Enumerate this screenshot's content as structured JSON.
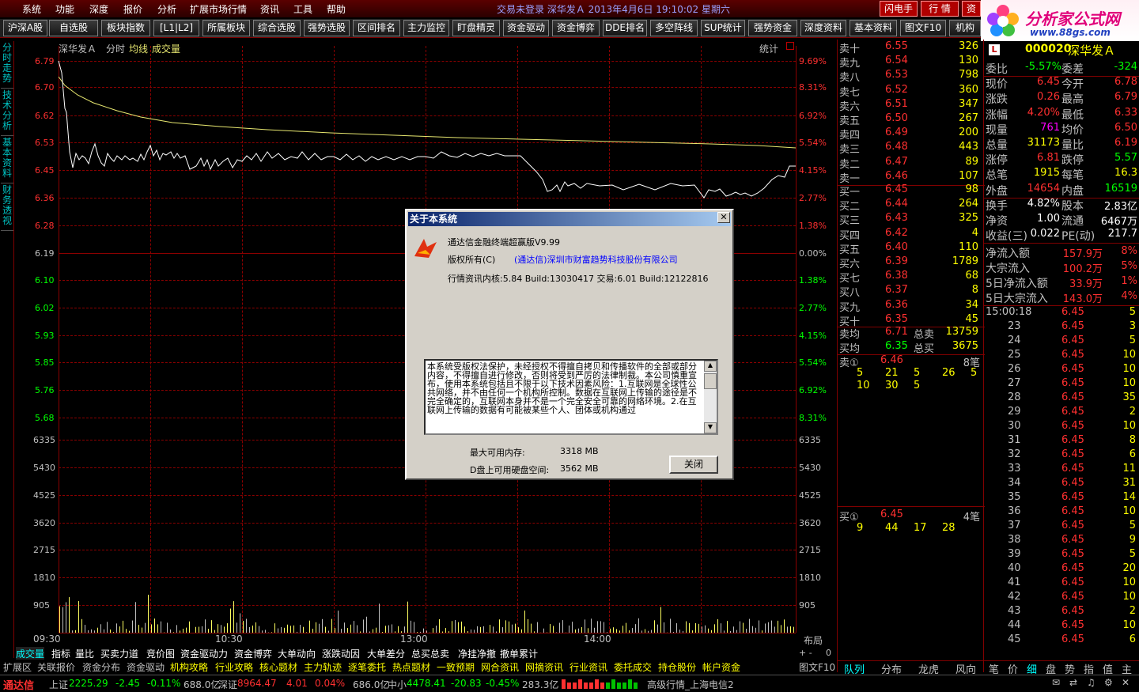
{
  "menu": {
    "items": [
      "系统",
      "功能",
      "深度",
      "报价",
      "分析",
      "扩展市场行情",
      "资讯",
      "工具",
      "帮助"
    ],
    "title_info": "交易未登录    深华发Ａ    2013年4月6日  19:10:02  星期六",
    "flash_label": "闪电手",
    "quote_label": "行 情",
    "extra_label": "资"
  },
  "logo": {
    "text": "分析家公式网",
    "url": "www.88gs.com"
  },
  "toolbar": [
    "沪深A股",
    "自选股",
    "板块指数",
    "[L1|L2]",
    "所属板块",
    "综合选股",
    "强势选股",
    "区间排名",
    "主力监控",
    "盯盘精灵",
    "资金驱动",
    "资金博弈",
    "DDE排名",
    "多空阵线",
    "SUP统计",
    "强势资金",
    "深度资料",
    "基本资料",
    "图文F10",
    "机构"
  ],
  "left_tabs": [
    "分时走势",
    "技术分析",
    "基本资料",
    "财务透视"
  ],
  "chart": {
    "header_name": "深华发Ａ",
    "header_mode": "分时",
    "header_avg": "均线",
    "header_vol": "成交量",
    "stats_label": "统计",
    "price_labels": [
      "6.79",
      "6.70",
      "6.62",
      "6.53",
      "6.45",
      "6.36",
      "6.28",
      "6.19",
      "6.10",
      "6.02",
      "5.93",
      "5.85",
      "5.76",
      "5.68"
    ],
    "pct_labels": [
      "9.69%",
      "8.31%",
      "6.92%",
      "5.54%",
      "4.15%",
      "2.77%",
      "1.38%",
      "0.00%",
      "1.38%",
      "2.77%",
      "4.15%",
      "5.54%",
      "6.92%",
      "8.31%"
    ],
    "vol_labels": [
      "6335",
      "5430",
      "4525",
      "3620",
      "2715",
      "1810",
      "905"
    ],
    "time_labels": [
      "09:30",
      "10:30",
      "13:00",
      "14:00"
    ],
    "layout_label": "布局",
    "plus_minus": "+ -",
    "zero": "0",
    "colors": {
      "up": "#ff3030",
      "down": "#00ff00",
      "price_line": "#ffffff",
      "avg_line": "#e8e870",
      "grid": "#8b0000"
    }
  },
  "bottom_tabs1": [
    "成交量",
    "指标",
    "量比",
    "买卖力道",
    "竞价图",
    "资金驱动力",
    "资金博弈",
    "大单动向",
    "涨跌动因",
    "大单差分",
    "总买总卖",
    "净挂净撤",
    "撤单累计"
  ],
  "bottom_tabs2": [
    "扩展区",
    "关联报价",
    "资金分布",
    "资金驱动",
    "机构攻略",
    "行业攻略",
    "核心题材",
    "主力轨迹",
    "逐笔委托",
    "热点题材",
    "一致预期",
    "网合资讯",
    "网摘资讯",
    "行业资讯",
    "委托成交",
    "持仓股份",
    "帐户资金"
  ],
  "graphic_f10": "图文F10",
  "orderbook": {
    "sells": [
      {
        "label": "卖十",
        "price": "6.55",
        "vol": "326"
      },
      {
        "label": "卖九",
        "price": "6.54",
        "vol": "130"
      },
      {
        "label": "卖八",
        "price": "6.53",
        "vol": "798"
      },
      {
        "label": "卖七",
        "price": "6.52",
        "vol": "360"
      },
      {
        "label": "卖六",
        "price": "6.51",
        "vol": "347"
      },
      {
        "label": "卖五",
        "price": "6.50",
        "vol": "267"
      },
      {
        "label": "卖四",
        "price": "6.49",
        "vol": "200"
      },
      {
        "label": "卖三",
        "price": "6.48",
        "vol": "443"
      },
      {
        "label": "卖二",
        "price": "6.47",
        "vol": "89"
      },
      {
        "label": "卖一",
        "price": "6.46",
        "vol": "107"
      }
    ],
    "buys": [
      {
        "label": "买一",
        "price": "6.45",
        "vol": "98"
      },
      {
        "label": "买二",
        "price": "6.44",
        "vol": "264"
      },
      {
        "label": "买三",
        "price": "6.43",
        "vol": "325"
      },
      {
        "label": "买四",
        "price": "6.42",
        "vol": "4"
      },
      {
        "label": "买五",
        "price": "6.40",
        "vol": "110"
      },
      {
        "label": "买六",
        "price": "6.39",
        "vol": "1789"
      },
      {
        "label": "买七",
        "price": "6.38",
        "vol": "68"
      },
      {
        "label": "买八",
        "price": "6.37",
        "vol": "8"
      },
      {
        "label": "买九",
        "price": "6.36",
        "vol": "34"
      },
      {
        "label": "买十",
        "price": "6.35",
        "vol": "45"
      }
    ],
    "sell_avg_label": "卖均",
    "sell_avg": "6.71",
    "total_sell_label": "总卖",
    "total_sell": "13759",
    "buy_avg_label": "买均",
    "buy_avg": "6.35",
    "total_buy_label": "总买",
    "total_buy": "3675",
    "sell_queue_label": "卖①",
    "sell_queue_price": "6.46",
    "sell_queue_count": "8笔",
    "sell_queue": [
      "5",
      "21",
      "5",
      "26",
      "5",
      "10",
      "30",
      "5"
    ],
    "buy_queue_label": "买①",
    "buy_queue_price": "6.45",
    "buy_queue_count": "4笔",
    "buy_queue": [
      "9",
      "44",
      "17",
      "28"
    ],
    "tabs": [
      "队列",
      "分布",
      "龙虎",
      "风向"
    ]
  },
  "quote": {
    "code": "000020",
    "name": "深华发Ａ",
    "badge": "L",
    "rows": [
      [
        "委比",
        "-5.57%",
        "委差",
        "-324"
      ],
      [
        "现价",
        "6.45",
        "今开",
        "6.78"
      ],
      [
        "涨跌",
        "0.26",
        "最高",
        "6.79"
      ],
      [
        "涨幅",
        "4.20%",
        "最低",
        "6.33"
      ],
      [
        "现量",
        "761",
        "均价",
        "6.50"
      ],
      [
        "总量",
        "31173",
        "量比",
        "6.19"
      ],
      [
        "涨停",
        "6.81",
        "跌停",
        "5.57"
      ],
      [
        "总笔",
        "1915",
        "每笔",
        "16.3"
      ],
      [
        "外盘",
        "14654",
        "内盘",
        "16519"
      ],
      [
        "换手",
        "4.82%",
        "股本",
        "2.83亿"
      ],
      [
        "净资",
        "1.00",
        "流通",
        "6467万"
      ],
      [
        "收益(三)",
        "0.022",
        "PE(动)",
        "217.7"
      ]
    ],
    "flows": [
      [
        "净流入额",
        "157.9万",
        "8%"
      ],
      [
        "大宗流入",
        "100.2万",
        "5%"
      ],
      [
        "5日净流入额",
        "33.9万",
        "1%"
      ],
      [
        "5日大宗流入",
        "143.0万",
        "4%"
      ]
    ],
    "ticks_first_time": "15:00:18",
    "ticks": [
      [
        "",
        "6.45",
        "5"
      ],
      [
        "23",
        "6.45",
        "3"
      ],
      [
        "24",
        "6.45",
        "5"
      ],
      [
        "25",
        "6.45",
        "10"
      ],
      [
        "26",
        "6.45",
        "10"
      ],
      [
        "27",
        "6.45",
        "10"
      ],
      [
        "28",
        "6.45",
        "35"
      ],
      [
        "29",
        "6.45",
        "2"
      ],
      [
        "30",
        "6.45",
        "10"
      ],
      [
        "31",
        "6.45",
        "8"
      ],
      [
        "32",
        "6.45",
        "6"
      ],
      [
        "33",
        "6.45",
        "11"
      ],
      [
        "34",
        "6.45",
        "31"
      ],
      [
        "35",
        "6.45",
        "14"
      ],
      [
        "36",
        "6.45",
        "10"
      ],
      [
        "37",
        "6.45",
        "5"
      ],
      [
        "38",
        "6.45",
        "9"
      ],
      [
        "39",
        "6.45",
        "5"
      ],
      [
        "40",
        "6.45",
        "20"
      ],
      [
        "41",
        "6.45",
        "10"
      ],
      [
        "42",
        "6.45",
        "10"
      ],
      [
        "43",
        "6.45",
        "2"
      ],
      [
        "44",
        "6.45",
        "10"
      ],
      [
        "45",
        "6.45",
        "6"
      ]
    ],
    "tabs": [
      "笔",
      "价",
      "细",
      "盘",
      "势",
      "指",
      "值",
      "主"
    ]
  },
  "status": {
    "brand": "通达信",
    "sh_label": "上证",
    "sh": "2225.29",
    "sh_chg": "-2.45",
    "sh_pct": "-0.11%",
    "sh_amt": "688.0亿",
    "sz_label": "深证",
    "sz": "8964.47",
    "sz_chg": "4.01",
    "sz_pct": "0.04%",
    "sz_amt": "686.0亿",
    "zx_label": "中小",
    "zx": "4478.41",
    "zx_chg": "-20.83",
    "zx_pct": "-0.45%",
    "zx_amt": "283.3亿",
    "server": "高级行情_上海电信2"
  },
  "dialog": {
    "title": "关于本系统",
    "product": "通达信金融终端超赢版V9.99",
    "copyright_label": "版权所有(C)",
    "company": "(通达信)深圳市财富趋势科技股份有限公司",
    "build": "行情资讯内核:5.84 Build:13030417 交易:6.01 Build:12122816",
    "notice": "本系统受版权法保护，未经授权不得擅自拷贝和传播软件的全部或部分内容，不得擅自进行修改，否则将受到严厉的法律制裁。本公司慎重宣布，使用本系统包括且不限于以下技术因素风险：1.互联网是全球性公共网络，并不由任何一个机构所控制。数据在互联网上传输的途径是不完全确定的，互联网本身并不是一个完全安全可靠的网络环境。2.在互联网上传输的数据有可能被某些个人、团体或机构通过",
    "mem_label": "最大可用内存:",
    "mem": "3318 MB",
    "disk_label": "D盘上可用硬盘空间:",
    "disk": "3562 MB",
    "close_label": "关闭"
  }
}
